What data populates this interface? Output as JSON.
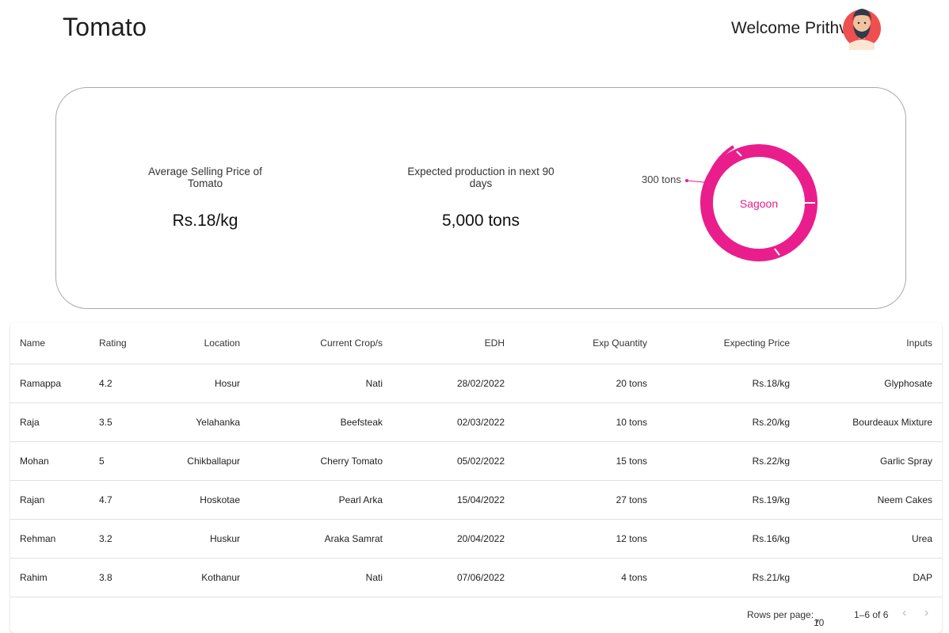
{
  "header": {
    "title": "Tomato",
    "welcome": "Welcome Prithvi"
  },
  "summary": {
    "avg_price_label": "Average Selling Price of Tomato",
    "avg_price_value": "Rs.18/kg",
    "production_label": "Expected production in next 90 days",
    "production_value": "5,000 tons"
  },
  "chart_data": {
    "type": "pie",
    "center_label": "Sagoon",
    "annotations": [
      "300 tons"
    ],
    "colors": {
      "main": "#e91e8c"
    }
  },
  "table": {
    "columns": [
      "Name",
      "Rating",
      "Location",
      "Current Crop/s",
      "EDH",
      "Exp Quantity",
      "Expecting Price",
      "Inputs"
    ],
    "rows": [
      [
        "Ramappa",
        "4.2",
        "Hosur",
        "Nati",
        "28/02/2022",
        "20 tons",
        "Rs.18/kg",
        "Glyphosate"
      ],
      [
        "Raja",
        "3.5",
        "Yelahanka",
        "Beefsteak",
        "02/03/2022",
        "10 tons",
        "Rs.20/kg",
        "Bourdeaux Mixture"
      ],
      [
        "Mohan",
        "5",
        "Chikballapur",
        "Cherry Tomato",
        "05/02/2022",
        "15 tons",
        "Rs.22/kg",
        "Garlic Spray"
      ],
      [
        "Rajan",
        "4.7",
        "Hoskotae",
        "Pearl Arka",
        "15/04/2022",
        "27 tons",
        "Rs.19/kg",
        "Neem Cakes"
      ],
      [
        "Rehman",
        "3.2",
        "Huskur",
        "Araka Samrat",
        "20/04/2022",
        "12 tons",
        "Rs.16/kg",
        "Urea"
      ],
      [
        "Rahim",
        "3.8",
        "Kothanur",
        "Nati",
        "07/06/2022",
        "4 tons",
        "Rs.21/kg",
        "DAP"
      ]
    ]
  },
  "pagination": {
    "rows_per_page_label": "Rows per page:",
    "rows_per_page_value": "10",
    "range": "1–6 of 6",
    "prev_icon": "chevron-left-icon",
    "next_icon": "chevron-right-icon"
  }
}
